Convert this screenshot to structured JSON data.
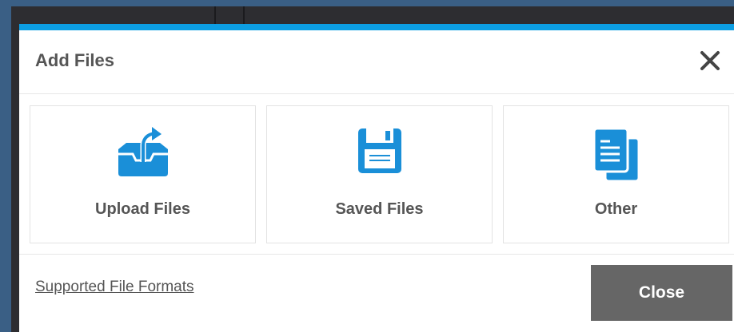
{
  "dialog": {
    "title": "Add Files",
    "accent_color": "#0c9ee3",
    "close_icon": "close-icon"
  },
  "options": [
    {
      "label": "Upload Files",
      "icon": "upload-tray-icon"
    },
    {
      "label": "Saved Files",
      "icon": "floppy-disk-icon"
    },
    {
      "label": "Other",
      "icon": "documents-icon"
    }
  ],
  "footer": {
    "formats_link": "Supported File Formats",
    "close_label": "Close"
  }
}
